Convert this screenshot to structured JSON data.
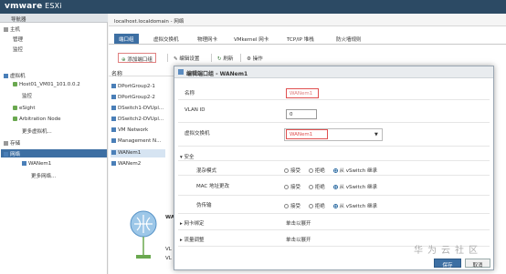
{
  "app": {
    "logo_main": "vmware",
    "logo_product": " ESXi"
  },
  "navigator": {
    "title": "导航器",
    "items": [
      {
        "label": "主机"
      },
      {
        "label": "管理"
      },
      {
        "label": "监控"
      },
      {
        "label": "虚拟机"
      },
      {
        "label": "Host01_VM01_101.0.0.2"
      },
      {
        "label": "监控"
      },
      {
        "label": "eSight"
      },
      {
        "label": "Arbitration Node"
      },
      {
        "label": "更多虚拟机..."
      },
      {
        "label": "存储"
      },
      {
        "label": "网络"
      },
      {
        "label": "WANem1"
      },
      {
        "label": "更多网络..."
      }
    ]
  },
  "main": {
    "title": "localhost.localdomain - 网络",
    "tabs": [
      "端口组",
      "虚拟交换机",
      "物理网卡",
      "VMkernel 网卡",
      "TCP/IP 堆栈",
      "防火墙规则"
    ],
    "toolbar": {
      "add": "添加端口组",
      "edit": "编辑设置",
      "refresh": "刷新",
      "actions": "操作"
    },
    "list_header": "名称",
    "rows": [
      "DPortGroup2-1",
      "DPortGroup2-2",
      "DSwitch1-DVUpl...",
      "DSwitch2-DVUpl...",
      "VM Network",
      "Management N...",
      "WANem1",
      "WANem2"
    ],
    "map_label_1": "WAN",
    "map_label_2": "VL",
    "map_label_3": "VL"
  },
  "modal": {
    "title": "编辑端口组 - WANem1",
    "name_label": "名称",
    "name_value": "WANem1",
    "vlan_label": "VLAN ID",
    "vlan_value": "0",
    "vswitch_label": "虚拟交换机",
    "vswitch_value": "WANem1",
    "security_label": "安全",
    "promiscuous_label": "混杂模式",
    "mac_label": "MAC 地址更改",
    "forged_label": "伪传输",
    "opt_accept": "接受",
    "opt_reject": "拒绝",
    "opt_inherit": "从 vSwitch 继承",
    "nic_teaming_label": "网卡绑定",
    "traffic_shaping_label": "流量调整",
    "expand_hint": "单击以展开",
    "save_label": "保存",
    "cancel_label": "取消"
  },
  "watermark": "华为云社区",
  "colors": {
    "header": "#2c4a64",
    "selection": "#3d6fa3",
    "highlight": "#e05050"
  }
}
